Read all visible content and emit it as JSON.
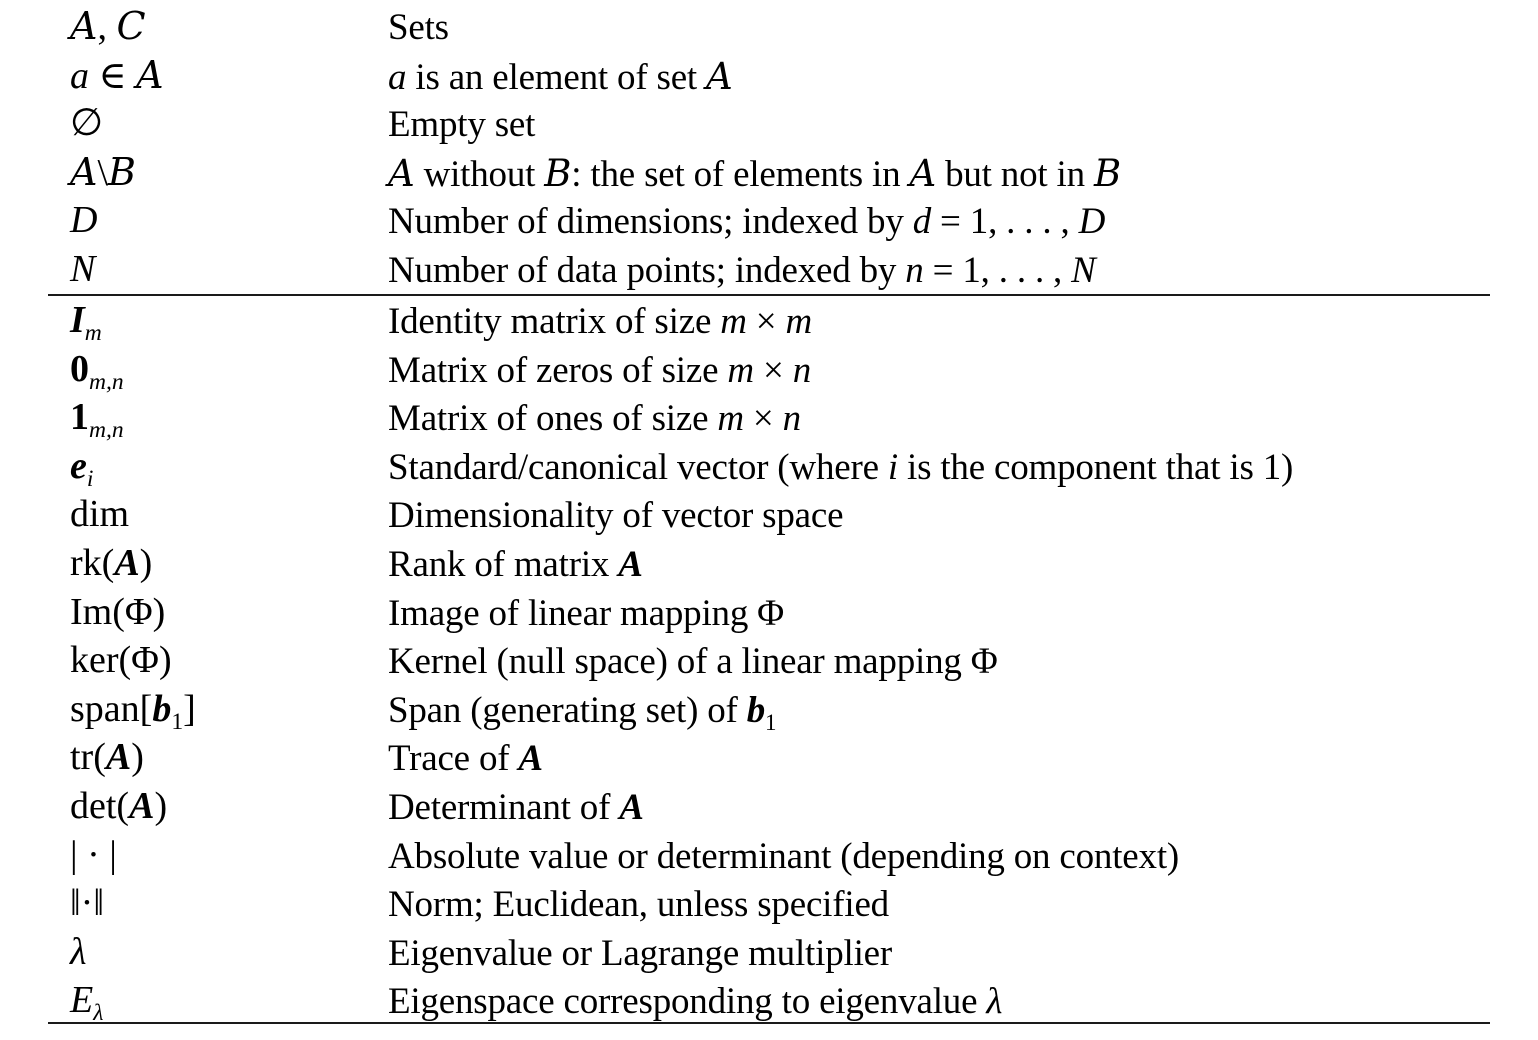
{
  "table": {
    "section1": [
      {
        "symbol_html": "<span class='cal'>A</span>, <span class='cal'>C</span>",
        "symbol_text": "A, C",
        "description_html": "Sets"
      },
      {
        "symbol_html": "<span class='m'>a</span> ∈ <span class='cal'>A</span>",
        "symbol_text": "a ∈ A",
        "description_html": "<span class='m'>a</span> is an element of set <span class='cal'>A</span>"
      },
      {
        "symbol_html": "∅",
        "symbol_text": "∅",
        "description_html": "Empty set"
      },
      {
        "symbol_html": "<span class='cal'>A</span>\\<span class='cal'>B</span>",
        "symbol_text": "A\\B",
        "description_html": "<span class='cal'>A</span> without <span class='cal'>B</span>: the set of elements in <span class='cal'>A</span> but not in <span class='cal'>B</span>"
      },
      {
        "symbol_html": "<span class='m'>D</span>",
        "symbol_text": "D",
        "description_html": "Number of dimensions; indexed by <span class='m'>d</span> = 1, . . . , <span class='m'>D</span>"
      },
      {
        "symbol_html": "<span class='m'>N</span>",
        "symbol_text": "N",
        "description_html": "Number of data points; indexed by <span class='m'>n</span> = 1, . . . , <span class='m'>N</span>"
      }
    ],
    "section2": [
      {
        "symbol_html": "<span class='b'>I</span><sub class='m'>m</sub>",
        "symbol_text": "I_m",
        "description_html": "Identity matrix of size <span class='m'>m</span> × <span class='m'>m</span>"
      },
      {
        "symbol_html": "<span class='bu'>0</span><sub class='m'>m,n</sub>",
        "symbol_text": "0_{m,n}",
        "description_html": "Matrix of zeros of size <span class='m'>m</span> × <span class='m'>n</span>"
      },
      {
        "symbol_html": "<span class='bu'>1</span><sub class='m'>m,n</sub>",
        "symbol_text": "1_{m,n}",
        "description_html": "Matrix of ones of size <span class='m'>m</span> × <span class='m'>n</span>"
      },
      {
        "symbol_html": "<span class='b'>e</span><sub class='m'>i</sub>",
        "symbol_text": "e_i",
        "description_html": "Standard/canonical vector (where <span class='m'>i</span> is the component that is 1)"
      },
      {
        "symbol_html": "dim",
        "symbol_text": "dim",
        "description_html": "Dimensionality of vector space"
      },
      {
        "symbol_html": "rk(<span class='b'>A</span>)",
        "symbol_text": "rk(A)",
        "description_html": "Rank of matrix <span class='b'>A</span>"
      },
      {
        "symbol_html": "Im(Φ)",
        "symbol_text": "Im(Φ)",
        "description_html": "Image of linear mapping Φ"
      },
      {
        "symbol_html": "ker(Φ)",
        "symbol_text": "ker(Φ)",
        "description_html": "Kernel (null space) of a linear mapping Φ"
      },
      {
        "symbol_html": "span[<span class='b'>b</span><sub>1</sub>]",
        "symbol_text": "span[b_1]",
        "description_html": "Span (generating set) of <span class='b'>b</span><sub>1</sub>"
      },
      {
        "symbol_html": "tr(<span class='b'>A</span>)",
        "symbol_text": "tr(A)",
        "description_html": "Trace of <span class='b'>A</span>"
      },
      {
        "symbol_html": "det(<span class='b'>A</span>)",
        "symbol_text": "det(A)",
        "description_html": "Determinant of <span class='b'>A</span>"
      },
      {
        "symbol_html": "| · |",
        "symbol_text": "| · |",
        "description_html": "Absolute value or determinant (depending on context)"
      },
      {
        "symbol_html": "‖·‖",
        "symbol_text": "‖·‖",
        "description_html": "Norm; Euclidean, unless specified"
      },
      {
        "symbol_html": "<span class='m'>λ</span>",
        "symbol_text": "λ",
        "description_html": "Eigenvalue or Lagrange multiplier"
      },
      {
        "symbol_html": "<span class='m'>E</span><sub class='m'>λ</sub>",
        "symbol_text": "E_λ",
        "description_html": "Eigenspace corresponding to eigenvalue <span class='m'>λ</span>"
      }
    ]
  }
}
